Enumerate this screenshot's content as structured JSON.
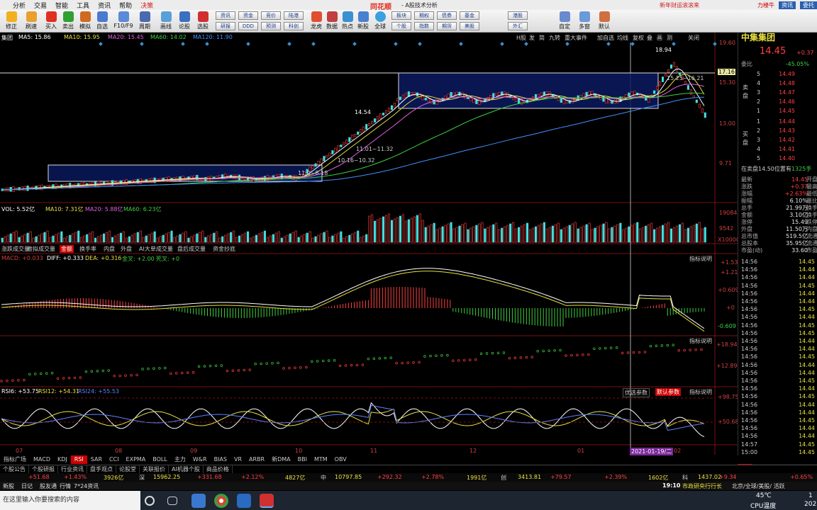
{
  "menu": {
    "items": [
      "",
      "分析",
      "交易",
      "智能",
      "工具",
      "资讯",
      "帮助",
      "决策"
    ],
    "brand": "同花顺",
    "title": "- A股技术分析",
    "promo": "新年财运滚滚来",
    "right": [
      "力楼牛",
      "资讯",
      "委托"
    ]
  },
  "toolbar": {
    "buttons": [
      "修正",
      "刷速",
      "买入",
      "卖出",
      "模拟",
      "自选",
      "F10/F9",
      "周期",
      "画线",
      "论股",
      "选股"
    ],
    "small_buttons": [
      "资讯",
      "研报",
      "资金",
      "DDD",
      "竞价",
      "预测",
      "陆港",
      "科创",
      "龙虎",
      "数据",
      "热点",
      "新股",
      "全球",
      "板块",
      "个股",
      "期权",
      "指数",
      "债券",
      "期货",
      "基金",
      "美股",
      "港股",
      "外汇",
      "自定",
      "多窗",
      "默认"
    ]
  },
  "chart": {
    "ma_legend": {
      "name": "集团",
      "ma5": "MA5: 15.86",
      "ma10": "MA10: 15.95",
      "ma20": "MA20: 15.45",
      "ma60": "MA60: 14.02",
      "ma120": "MA120: 11.90"
    },
    "top_right_tools": [
      "H股",
      "发",
      "简",
      "九转",
      "重大事件",
      "加自选",
      "均线",
      "复权",
      "叠",
      "画",
      "测",
      "关闭"
    ],
    "price_axis": [
      "19.60",
      "17.16",
      "15.30",
      "13.00",
      "9.71"
    ],
    "annotations": {
      "high": "18.94",
      "range1": "15.25~16.21",
      "pt1": "14.54",
      "range2": "11.01~11.32",
      "range3": "10.16~10.32",
      "range4": "11.0~8.18"
    },
    "vol_legend": {
      "vol": "VOL: 5.52亿",
      "ma10": "MA10: 7.31亿",
      "ma20": "MA20: 5.88亿",
      "ma60": "MA60: 6.23亿"
    },
    "vol_axis": [
      "19084",
      "9542",
      "X10000"
    ],
    "mid_tabs": [
      "涨跌成交量",
      "虚拟成交量",
      "金额",
      "换手率",
      "内盘",
      "外盘",
      "AI大单成交量",
      "盘后成交量",
      "资金抄底"
    ],
    "macd_legend": {
      "macd": "MACD: +0.033",
      "diff": "DIFF: +0.333",
      "dea": "DEA: +0.316",
      "gold": "金叉: +2.00",
      "dead": "死叉: +0"
    },
    "macd_axis": [
      "+1.53",
      "+1.21",
      "+0.609",
      "+0",
      "-0.609"
    ],
    "sar_axis": [
      "+18.94",
      "+12.89"
    ],
    "rsi_legend": {
      "r6": "RSI6: +53.75",
      "r12": "RSI12: +54.31",
      "r24": "RSI24: +55.53"
    },
    "rsi_axis": [
      "+98.75",
      "+50.68"
    ],
    "rsi_buttons": [
      "优选参数",
      "默认参数",
      "指标说明"
    ],
    "indicator_hint": "指标说明",
    "months": [
      "07",
      "08",
      "09",
      "10",
      "11",
      "12",
      "01",
      "02"
    ],
    "cursor_date": "2021-01-19/二"
  },
  "right": {
    "code": "",
    "name": "中集集团",
    "price": "14.45",
    "change": "+0.37",
    "weibi_label": "委比",
    "weibi": "-45.05%",
    "sell": [
      {
        "label": "5",
        "price": "14.49",
        "vol": ""
      },
      {
        "label": "4",
        "price": "14.48",
        "vol": ""
      },
      {
        "label": "3",
        "price": "14.47",
        "vol": ""
      },
      {
        "label": "2",
        "price": "14.46",
        "vol": ""
      },
      {
        "label": "1",
        "price": "14.45",
        "vol": ""
      }
    ],
    "buy": [
      {
        "label": "1",
        "price": "14.44",
        "vol": ""
      },
      {
        "label": "2",
        "price": "14.43",
        "vol": ""
      },
      {
        "label": "3",
        "price": "14.42",
        "vol": ""
      },
      {
        "label": "4",
        "price": "14.41",
        "vol": ""
      },
      {
        "label": "5",
        "price": "14.40",
        "vol": ""
      }
    ],
    "ask_label": "卖盘",
    "bid_label": "买盘",
    "note": "在卖盘14.50位置有",
    "note_vol": "1325手",
    "stats": [
      {
        "label": "最新",
        "value": "14.45",
        "right": "开盘"
      },
      {
        "label": "涨跌",
        "value": "+0.37",
        "right": "最高"
      },
      {
        "label": "涨幅",
        "value": "+2.63%",
        "right": "最低"
      },
      {
        "label": "振幅",
        "value": "6.10%",
        "right": "量比"
      },
      {
        "label": "总手",
        "value": "21.99万",
        "right": "换手"
      },
      {
        "label": "金额",
        "value": "3.10亿",
        "right": "换手"
      },
      {
        "label": "涨停",
        "value": "15.49",
        "right": "跌停"
      },
      {
        "label": "外盘",
        "value": "11.50万",
        "right": "内盘"
      },
      {
        "label": "总市值",
        "value": "519.5亿",
        "right": "流通"
      },
      {
        "label": "总股本",
        "value": "35.95亿",
        "right": "流通"
      },
      {
        "label": "市盈(动)",
        "value": "33.60",
        "right": "市盈"
      }
    ],
    "ticks": [
      {
        "t": "14:56",
        "p": "14.45"
      },
      {
        "t": "14:56",
        "p": "14.44"
      },
      {
        "t": "14:56",
        "p": "14.44"
      },
      {
        "t": "14:56",
        "p": "14.45"
      },
      {
        "t": "14:56",
        "p": "14.44"
      },
      {
        "t": "14:56",
        "p": "14.44"
      },
      {
        "t": "14:56",
        "p": "14.45"
      },
      {
        "t": "14:56",
        "p": "14.44"
      },
      {
        "t": "14:56",
        "p": "14.45"
      },
      {
        "t": "14:56",
        "p": "14.45"
      },
      {
        "t": "14:56",
        "p": "14.44"
      },
      {
        "t": "14:56",
        "p": "14.44"
      },
      {
        "t": "14:56",
        "p": "14.45"
      },
      {
        "t": "14:56",
        "p": "14.44"
      },
      {
        "t": "14:56",
        "p": "14.44"
      },
      {
        "t": "14:56",
        "p": "14.45"
      },
      {
        "t": "14:56",
        "p": "14.44"
      },
      {
        "t": "14:56",
        "p": "14.45"
      },
      {
        "t": "14:56",
        "p": "14.44"
      },
      {
        "t": "14:56",
        "p": "14.44"
      },
      {
        "t": "14:56",
        "p": "14.45"
      },
      {
        "t": "14:56",
        "p": "14.44"
      },
      {
        "t": "14:56",
        "p": "14.44"
      },
      {
        "t": "14:57",
        "p": "14.45"
      },
      {
        "t": "15:00",
        "p": "14.45"
      }
    ],
    "bottom_tabs": [
      "细",
      "分",
      "势",
      "笔",
      "价"
    ]
  },
  "bottom": {
    "indicator_tabs": [
      "指标广场",
      "MACD",
      "KDJ",
      "RSI",
      "SAR",
      "CCI",
      "EXPMA",
      "BOLL",
      "主力",
      "W&R",
      "BIAS",
      "VR",
      "ARBR",
      "新DMA",
      "BBI",
      "MTM",
      "OBV"
    ],
    "active_tab": "RSI",
    "nav_tabs": [
      "个股公告",
      "个股研报",
      "行业资讯",
      "盘手观点",
      "论股堂",
      "关联报价",
      "AI机器个股",
      "商品价格"
    ],
    "index": [
      "+51.68",
      "+1.43%",
      "3926亿",
      "深",
      "15962.25",
      "+331.68",
      "+2.12%",
      "4827亿",
      "中",
      "10797.85",
      "+292.32",
      "+2.78%",
      "1991亿",
      "创",
      "3413.81",
      "+79.57",
      "+2.39%",
      "1602亿",
      "科",
      "1437.02",
      "+9.34",
      "+0.65%"
    ],
    "news_left": [
      "新股",
      "日记",
      "股友通",
      "行情",
      "7*24资讯"
    ],
    "news_time": "19:10",
    "news_text": "市政研央行行长",
    "news_right": "北京/全球/美股/ 活跃"
  },
  "taskbar": {
    "search": "在这里输入你要搜索的内容",
    "temp": "45℃",
    "temp_label": "CPU温度",
    "time": "1",
    "date": "202"
  },
  "chart_data": {
    "type": "candlestick",
    "title": "中集集团",
    "months": [
      "07",
      "08",
      "09",
      "10",
      "11",
      "12",
      "01",
      "02"
    ],
    "price_axis": [
      19.6,
      17.16,
      15.3,
      13.0,
      9.71
    ],
    "high": 18.94,
    "last": 14.45
  }
}
